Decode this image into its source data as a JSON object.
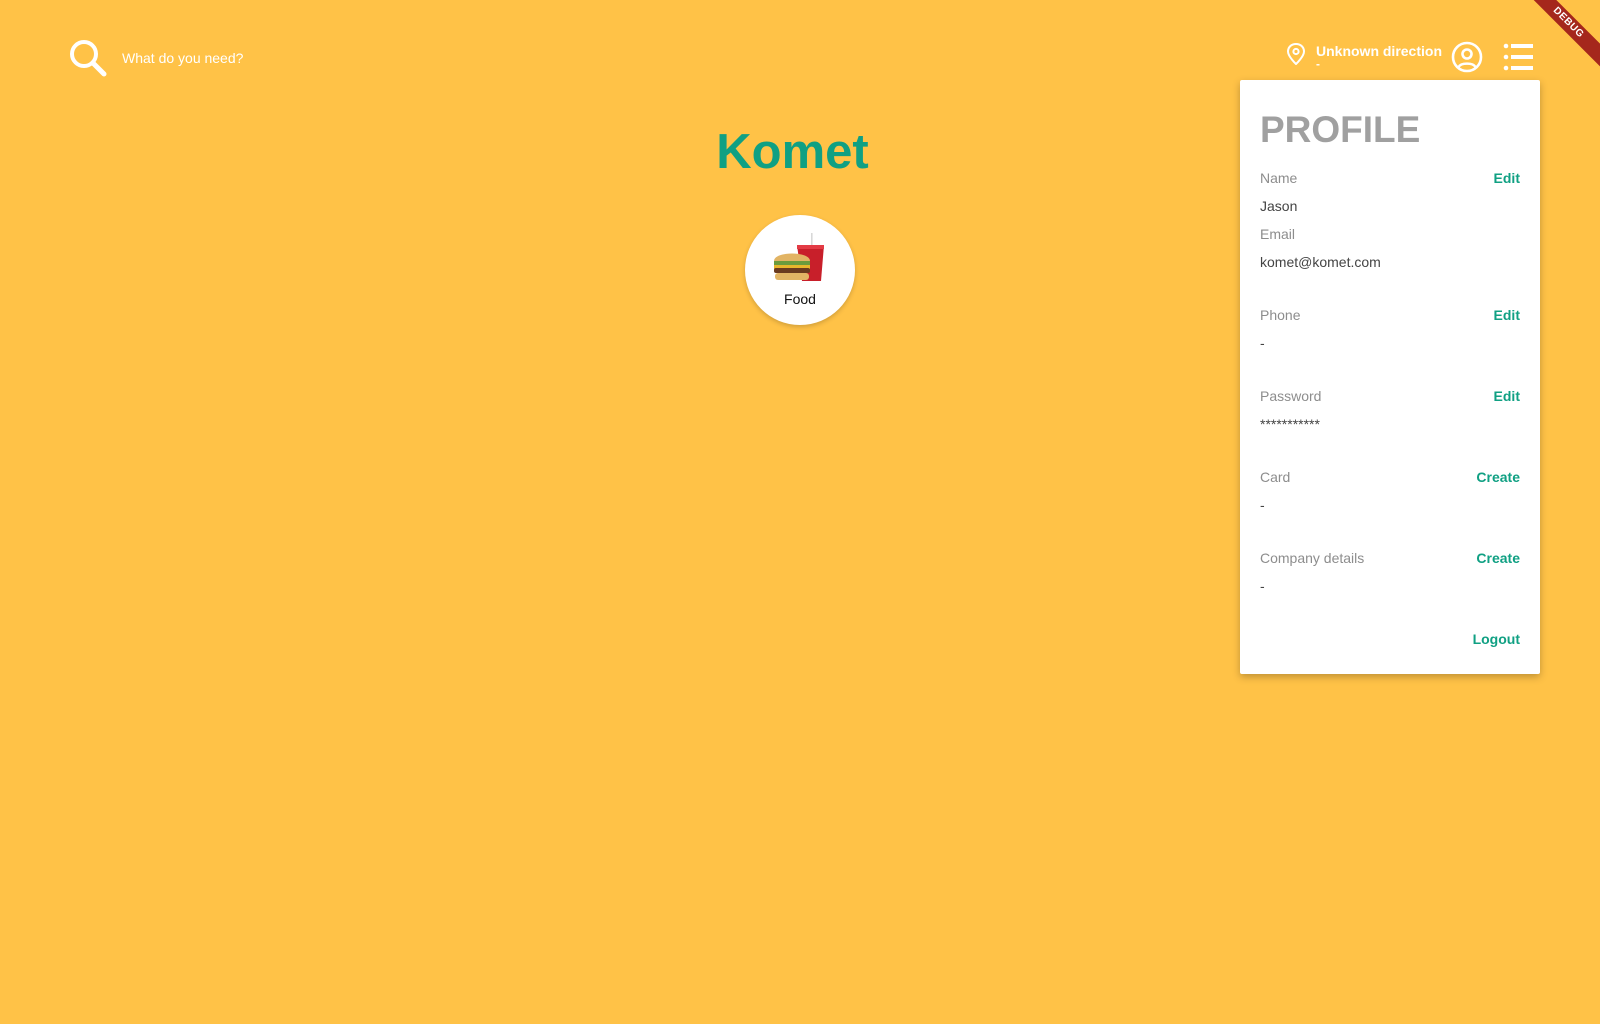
{
  "search": {
    "placeholder": "What do you need?"
  },
  "location": {
    "title": "Unknown direction",
    "subtitle": "-"
  },
  "brand": {
    "title": "Komet"
  },
  "categories": [
    {
      "label": "Food",
      "icon": "burger-and-drink-icon"
    }
  ],
  "debug_banner": "DEBUG",
  "profile": {
    "title": "PROFILE",
    "fields": [
      {
        "label": "Name",
        "value": "Jason",
        "action": "Edit"
      },
      {
        "label": "Email",
        "value": "komet@komet.com"
      },
      {
        "label": "Phone",
        "value": "-",
        "action": "Edit"
      },
      {
        "label": "Password",
        "value": "***********",
        "action": "Edit"
      },
      {
        "label": "Card",
        "value": "-",
        "action": "Create"
      },
      {
        "label": "Company details",
        "value": "-",
        "action": "Create"
      }
    ],
    "logout_label": "Logout"
  },
  "colors": {
    "background": "#FFC247",
    "accent": "#10A083",
    "panel_title": "#A0A0A0",
    "debug_ribbon": "#A5271C"
  }
}
